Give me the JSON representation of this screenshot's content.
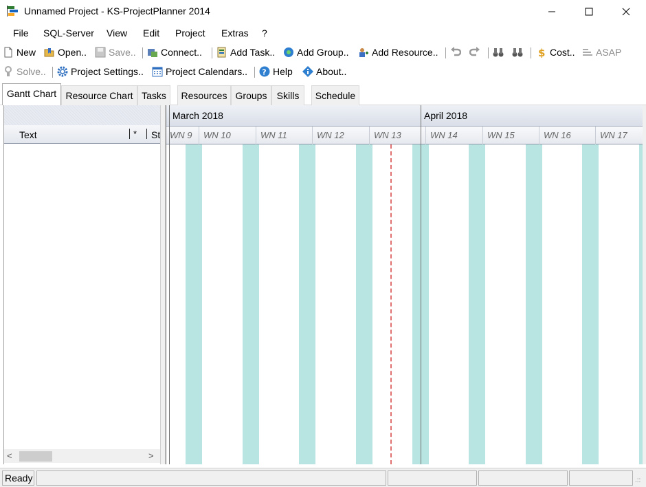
{
  "window": {
    "title": "Unnamed Project - KS-ProjectPlanner 2014",
    "app_icon": "project-planner-icon",
    "controls": {
      "minimize": "─",
      "maximize": "☐",
      "close": "✕"
    }
  },
  "menu": [
    "File",
    "SQL-Server",
    "View",
    "Edit",
    "Project",
    "Extras",
    "?"
  ],
  "toolbar1": {
    "new": "New",
    "open": "Open..",
    "save": "Save..",
    "connect": "Connect..",
    "add_task": "Add Task..",
    "add_group": "Add Group..",
    "add_resource": "Add Resource..",
    "cost": "Cost..",
    "asap": "ASAP"
  },
  "toolbar2": {
    "solve": "Solve..",
    "project_settings": "Project Settings..",
    "project_calendars": "Project Calendars..",
    "help": "Help",
    "about": "About.."
  },
  "tabs": [
    "Gantt Chart",
    "Resource Chart",
    "Tasks",
    "Resources",
    "Groups",
    "Skills",
    "Schedule"
  ],
  "active_tab": "Gantt Chart",
  "grid": {
    "columns": {
      "text": "Text",
      "star": "*",
      "st": "St"
    }
  },
  "gantt": {
    "months": [
      "March 2018",
      "April 2018"
    ],
    "weeks": [
      "WN 9",
      "WN 10",
      "WN 11",
      "WN 12",
      "WN 13",
      "WN 14",
      "WN 15",
      "WN 16",
      "WN 17"
    ],
    "weekend_color": "#b8e4e1",
    "today_line_color": "#e07070"
  },
  "scroll": {
    "left": "<",
    "right": ">"
  },
  "status": {
    "text": "Ready",
    "grip": ".::"
  }
}
